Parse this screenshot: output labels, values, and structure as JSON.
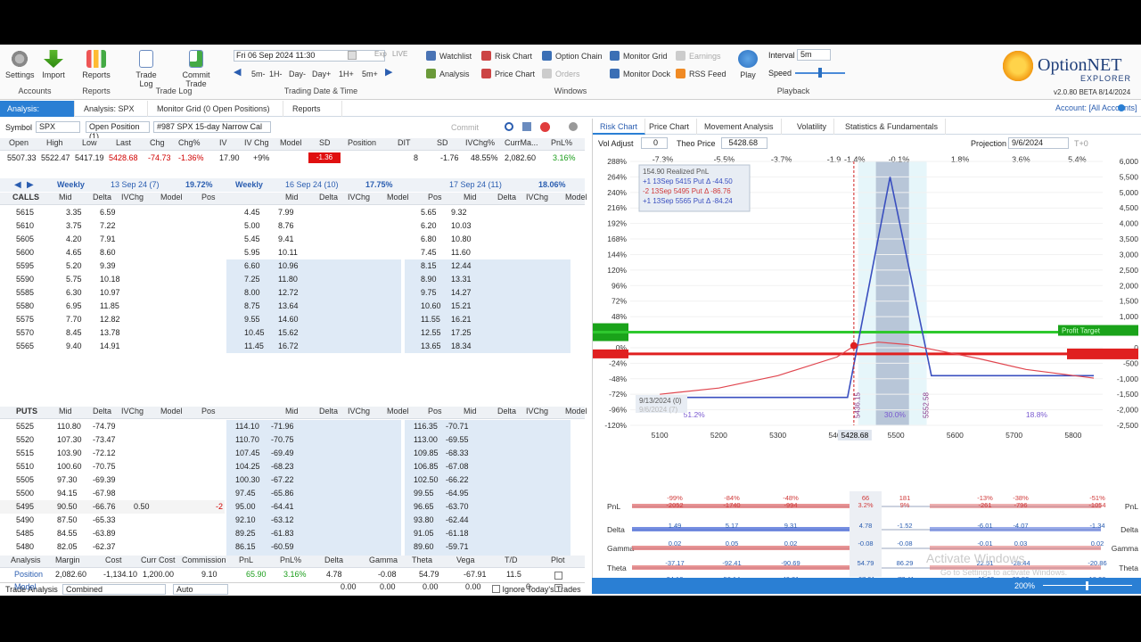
{
  "ribbon": {
    "settings": "Settings",
    "import": "Import",
    "accounts": "Accounts",
    "reports_btn": "Reports",
    "reports_grp": "Reports",
    "trade_log_btn": "Trade Log",
    "commit_trade": "Commit Trade",
    "trade_log_grp": "Trade Log",
    "datetime": "Fri 06 Sep 2024 11:30",
    "exp": "Exp",
    "live": "LIVE",
    "steps": [
      "5m-",
      "1H-",
      "Day-",
      "Day+",
      "1H+",
      "5m+"
    ],
    "dt_grp": "Trading Date & Time",
    "watchlist": "Watchlist",
    "risk_chart": "Risk Chart",
    "option_chain": "Option Chain",
    "monitor_grid": "Monitor Grid",
    "earnings": "Earnings",
    "analysis": "Analysis",
    "price_chart": "Price Chart",
    "orders": "Orders",
    "monitor_dock": "Monitor Dock",
    "rss": "RSS Feed",
    "windows_grp": "Windows",
    "play": "Play",
    "interval_lbl": "Interval",
    "interval_val": "5m",
    "speed_lbl": "Speed",
    "playback_grp": "Playback",
    "logo": "OptionNET",
    "logo2": "EXPLORER",
    "version": "v2.0.80 BETA 8/14/2024",
    "account": "Account: [All Accounts]"
  },
  "tabs": [
    "Analysis: SPX",
    "Analysis: SPX",
    "Monitor Grid (0 Open Positions)",
    "Reports"
  ],
  "left": {
    "symbol_lbl": "Symbol",
    "symbol": "SPX",
    "open_pos": "Open Position (1)",
    "position_name": "#987 SPX 15-day Narrow Cal",
    "commit": "Commit",
    "qhdr": [
      "Open",
      "High",
      "Low",
      "Last",
      "Chg",
      "Chg%",
      "IV",
      "IV Chg",
      "Model",
      "SD",
      "Position"
    ],
    "qvals": [
      "5507.33",
      "5522.47",
      "5417.19",
      "5428.68",
      "-74.73",
      "-1.36%",
      "17.90",
      "+9%",
      "",
      "-1.36",
      ""
    ],
    "phdr": [
      "DIT",
      "SD",
      "IVChg%",
      "CurrMa...",
      "PnL%"
    ],
    "pvals": [
      "8",
      "-1.76",
      "48.55%",
      "2,082.60",
      "3.16%"
    ],
    "exps": [
      {
        "name": "Weekly",
        "date": "13 Sep 24 (7)",
        "iv": "19.72%"
      },
      {
        "name": "Weekly",
        "date": "16 Sep 24 (10)",
        "iv": "17.75%"
      },
      {
        "name": "",
        "date": "17 Sep 24 (11)",
        "iv": "18.06%"
      }
    ],
    "calls_lbl": "CALLS",
    "puts_lbl": "PUTS",
    "colhdr": [
      "Mid",
      "Delta",
      "IVChg",
      "Model",
      "Pos"
    ],
    "calls": [
      [
        "5615",
        "3.35",
        "6.59",
        "4.45",
        "7.99",
        "5.65",
        "9.32"
      ],
      [
        "5610",
        "3.75",
        "7.22",
        "5.00",
        "8.76",
        "6.20",
        "10.03"
      ],
      [
        "5605",
        "4.20",
        "7.91",
        "5.45",
        "9.41",
        "6.80",
        "10.80"
      ],
      [
        "5600",
        "4.65",
        "8.60",
        "5.95",
        "10.11",
        "7.45",
        "11.60"
      ],
      [
        "5595",
        "5.20",
        "9.39",
        "6.60",
        "10.96",
        "8.15",
        "12.44"
      ],
      [
        "5590",
        "5.75",
        "10.18",
        "7.25",
        "11.80",
        "8.90",
        "13.31"
      ],
      [
        "5585",
        "6.30",
        "10.97",
        "8.00",
        "12.72",
        "9.75",
        "14.27"
      ],
      [
        "5580",
        "6.95",
        "11.85",
        "8.75",
        "13.64",
        "10.60",
        "15.21"
      ],
      [
        "5575",
        "7.70",
        "12.82",
        "9.55",
        "14.60",
        "11.55",
        "16.21"
      ],
      [
        "5570",
        "8.45",
        "13.78",
        "10.45",
        "15.62",
        "12.55",
        "17.25"
      ],
      [
        "5565",
        "9.40",
        "14.91",
        "11.45",
        "16.72",
        "13.65",
        "18.34"
      ]
    ],
    "puts": [
      [
        "5525",
        "110.80",
        "-74.79",
        "",
        "",
        "114.10",
        "-71.96",
        "116.35",
        "-70.71"
      ],
      [
        "5520",
        "107.30",
        "-73.47",
        "",
        "",
        "110.70",
        "-70.75",
        "113.00",
        "-69.55"
      ],
      [
        "5515",
        "103.90",
        "-72.12",
        "",
        "",
        "107.45",
        "-69.49",
        "109.85",
        "-68.33"
      ],
      [
        "5510",
        "100.60",
        "-70.75",
        "",
        "",
        "104.25",
        "-68.23",
        "106.85",
        "-67.08"
      ],
      [
        "5505",
        "97.30",
        "-69.39",
        "",
        "",
        "100.30",
        "-67.22",
        "102.50",
        "-66.22"
      ],
      [
        "5500",
        "94.15",
        "-67.98",
        "",
        "",
        "97.45",
        "-65.86",
        "99.55",
        "-64.95"
      ],
      [
        "5495",
        "90.50",
        "-66.76",
        "0.50",
        "-2",
        "95.00",
        "-64.41",
        "96.65",
        "-63.70"
      ],
      [
        "5490",
        "87.50",
        "-65.33",
        "",
        "",
        "92.10",
        "-63.12",
        "93.80",
        "-62.44"
      ],
      [
        "5485",
        "84.55",
        "-63.89",
        "",
        "",
        "89.25",
        "-61.83",
        "91.05",
        "-61.18"
      ],
      [
        "5480",
        "82.05",
        "-62.37",
        "",
        "",
        "86.15",
        "-60.59",
        "89.60",
        "-59.71"
      ],
      [
        "5475",
        "79.30",
        "-60.93",
        "",
        "",
        "83.55",
        "-59.28",
        "85.75",
        "-58.67"
      ]
    ],
    "ta_lbl": "Trade Analysis",
    "ta_mode": "Combined",
    "ta_auto": "Auto",
    "ignore": "Ignore Today's Trades",
    "ta_hdr": [
      "Analysis",
      "Margin",
      "Cost",
      "Curr Cost",
      "Commission",
      "PnL",
      "PnL%",
      "Delta",
      "Gamma",
      "Theta",
      "Vega",
      "T/D",
      "Plot"
    ],
    "ta_pos": [
      "Position",
      "2,082.60",
      "-1,134.10",
      "1,200.00",
      "9.10",
      "65.90",
      "3.16%",
      "4.78",
      "-0.08",
      "54.79",
      "-67.91",
      "11.5"
    ],
    "ta_model": [
      "Model",
      "",
      "",
      "",
      "",
      "",
      "",
      "0.00",
      "0.00",
      "0.00",
      "0.00",
      "0"
    ]
  },
  "right": {
    "tabs": [
      "Risk Chart",
      "Price Chart",
      "Movement Analysis",
      "Volatility",
      "Statistics & Fundamentals"
    ],
    "voladj_lbl": "Vol Adjust",
    "voladj": "0",
    "theo_lbl": "Theo Price",
    "theo": "5428.68",
    "proj_lbl": "Projection",
    "proj": "9/6/2024",
    "tplus": "T+0",
    "pct_top": [
      "-7.3%",
      "-5.5%",
      "-3.7%",
      "-1.9",
      "-1.4%",
      "-0.1%",
      "1.8%",
      "3.6%",
      "5.4%"
    ],
    "left_axis": [
      "288%",
      "264%",
      "240%",
      "216%",
      "192%",
      "168%",
      "144%",
      "120%",
      "96%",
      "72%",
      "48%",
      "24%",
      "0%",
      "-24%",
      "-48%",
      "-72%",
      "-96%",
      "-120%"
    ],
    "right_axis": [
      "6,000",
      "5,500",
      "5,000",
      "4,500",
      "4,000",
      "3,500",
      "3,000",
      "2,500",
      "2,000",
      "1,500",
      "1,000",
      "500",
      "0",
      "-500",
      "-1,000",
      "-1,500",
      "-2,000",
      "-2,500"
    ],
    "x_axis": [
      "5100",
      "5200",
      "5300",
      "5400",
      "5500",
      "5600",
      "5700",
      "5800"
    ],
    "x_cur": "5428.68",
    "legend": [
      "154.90 Realized PnL",
      "+1 13Sep 5415 Put Δ -44.50",
      "-2 13Sep 5495 Put Δ -86.76",
      "+1 13Sep 5565 Put Δ -84.24"
    ],
    "date_tag": "9/13/2024 (0)",
    "date_tag2": "9/6/2024 (7)",
    "pct_left": "51.2%",
    "pct_mid": "30.0%",
    "pct_right": "18.8%",
    "profit_target": "Profit Target",
    "vert1": "5436.15",
    "vert2": "5552.58",
    "greek_lbls": [
      "PnL",
      "Delta",
      "Gamma",
      "Theta",
      "Vega"
    ],
    "greek_vals": {
      "pnl": [
        "-99%",
        "-84%",
        "-48%",
        "66",
        "181",
        "-13%",
        "-38%",
        "-51%"
      ],
      "pnl2": [
        "-2052",
        "-1740",
        "-994",
        "3.2%",
        "9%",
        "-261",
        "-796",
        "-1054"
      ],
      "delta": [
        "1.49",
        "5.17",
        "9.31",
        "4.78",
        "-1.52",
        "-6.01",
        "-4.07",
        "-1.34"
      ],
      "gamma": [
        "0.02",
        "0.05",
        "0.02",
        "-0.08",
        "-0.08",
        "-0.01",
        "0.03",
        "0.02"
      ],
      "theta": [
        "-37.17",
        "-92.41",
        "-90.69",
        "54.79",
        "86.29",
        "22.51",
        "-28.44",
        "-20.86"
      ],
      "vega": [
        "24.12",
        "56.14",
        "40.81",
        "-67.91",
        "-77.41",
        "-11.32",
        "29.59",
        "18.28"
      ]
    },
    "zoom": "200%",
    "watermark": "Activate Windows",
    "watermark2": "Go to Settings to activate Windows."
  },
  "colors": {
    "accent": "#2a7fd4",
    "profit": "#1aa31a",
    "loss": "#e02020"
  }
}
